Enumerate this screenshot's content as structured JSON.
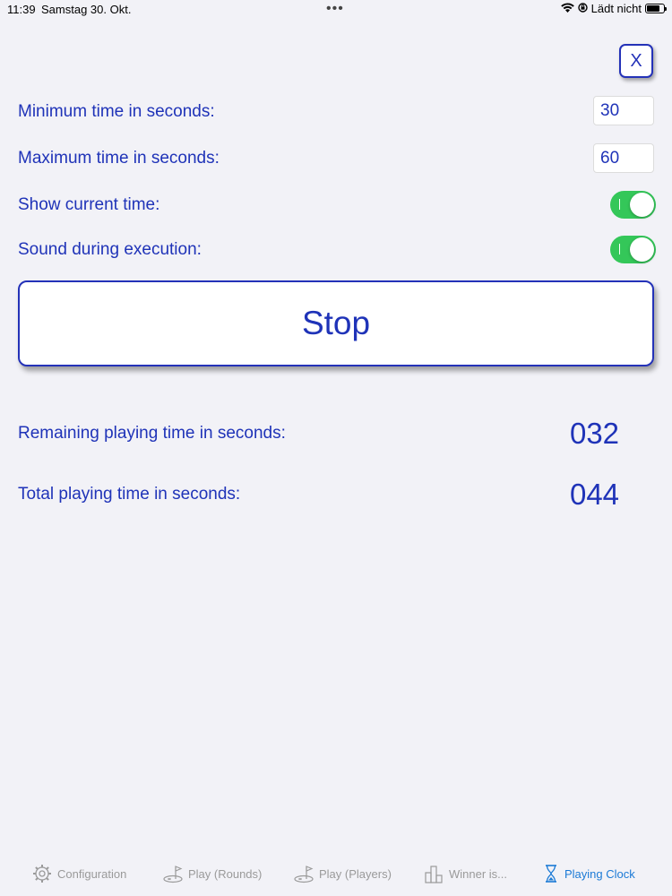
{
  "status_bar": {
    "time": "11:39",
    "date": "Samstag 30. Okt.",
    "dots": "•••",
    "charging_text": "Lädt nicht"
  },
  "close_button": {
    "label": "X"
  },
  "settings": {
    "min_time": {
      "label": "Minimum time in seconds:",
      "value": "30"
    },
    "max_time": {
      "label": "Maximum time in seconds:",
      "value": "60"
    },
    "show_current_time": {
      "label": "Show current time:",
      "on": true
    },
    "sound_during_execution": {
      "label": "Sound during execution:",
      "on": true
    }
  },
  "stop_button": {
    "label": "Stop"
  },
  "remaining": {
    "label": "Remaining playing time in seconds:",
    "value": "032"
  },
  "total": {
    "label": "Total playing time in seconds:",
    "value": "044"
  },
  "tab_bar": {
    "tabs": [
      {
        "label": "Configuration",
        "icon": "gear-icon"
      },
      {
        "label": "Play (Rounds)",
        "icon": "golf-icon"
      },
      {
        "label": "Play (Players)",
        "icon": "golf-icon"
      },
      {
        "label": "Winner is...",
        "icon": "podium-icon"
      },
      {
        "label": "Playing Clock",
        "icon": "hourglass-icon"
      }
    ],
    "active_color": "#1b7ad6",
    "inactive_color": "#9a9a9a"
  },
  "colors": {
    "accent": "#1f33b8",
    "toggle_on": "#34c759",
    "background": "#f2f2f7"
  }
}
